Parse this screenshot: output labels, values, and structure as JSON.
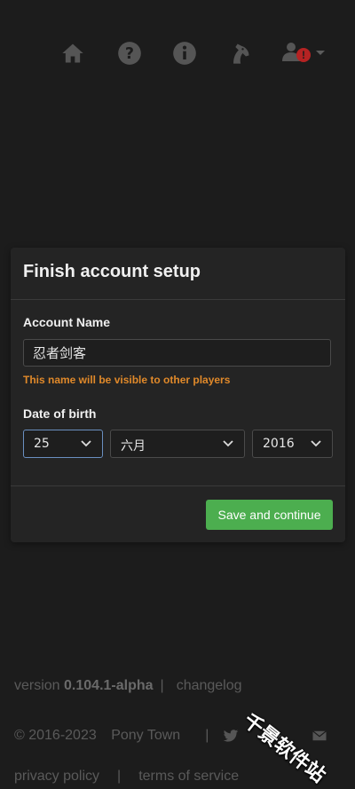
{
  "nav": {
    "icons": [
      "home-icon",
      "help-icon",
      "info-icon",
      "horse-icon",
      "user-icon"
    ],
    "badge": "!"
  },
  "modal": {
    "title": "Finish account setup",
    "account_name_label": "Account Name",
    "account_name_value": "忍者剑客",
    "hint": "This name will be visible to other players",
    "dob_label": "Date of birth",
    "day": "25",
    "month": "六月",
    "year": "2016",
    "save_label": "Save and continue"
  },
  "footer": {
    "version_prefix": "version",
    "version": "0.104.1-alpha",
    "pipe": "|",
    "changelog": "changelog",
    "copyright": "© 2016-2023",
    "pony_town": "Pony Town",
    "privacy": "privacy policy",
    "terms": "terms of service"
  },
  "watermark": "千景软件站",
  "colors": {
    "background": "#1c1c1c",
    "modal": "#242424",
    "accent_green": "#4cae4f",
    "warning_orange": "#e0892a",
    "badge_red": "#b52323"
  }
}
